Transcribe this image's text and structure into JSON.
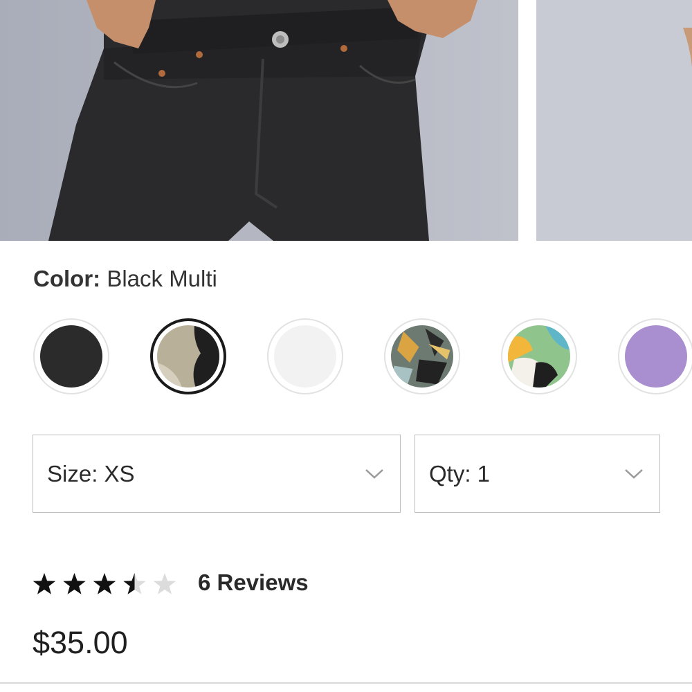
{
  "product": {
    "color": {
      "label": "Color:",
      "value": "Black Multi"
    },
    "swatches": [
      {
        "name": "black",
        "selected": false
      },
      {
        "name": "black-multi",
        "selected": true
      },
      {
        "name": "white",
        "selected": false
      },
      {
        "name": "print-floral",
        "selected": false
      },
      {
        "name": "multicolor-abstract",
        "selected": false
      },
      {
        "name": "lavender",
        "selected": false
      }
    ],
    "size_select": {
      "text": "Size: XS",
      "icon": "chevron-down-icon"
    },
    "qty_select": {
      "text": "Qty: 1",
      "icon": "chevron-down-icon"
    },
    "rating": {
      "value": 3.5,
      "max": 5
    },
    "reviews_label": "6 Reviews",
    "price": "$35.00"
  },
  "colors": {
    "star_filled": "#111111",
    "star_empty": "#dcdcdc",
    "border": "#bdbdbd",
    "swatch_black": "#2b2b2b",
    "swatch_lavender": "#a98fd0"
  }
}
